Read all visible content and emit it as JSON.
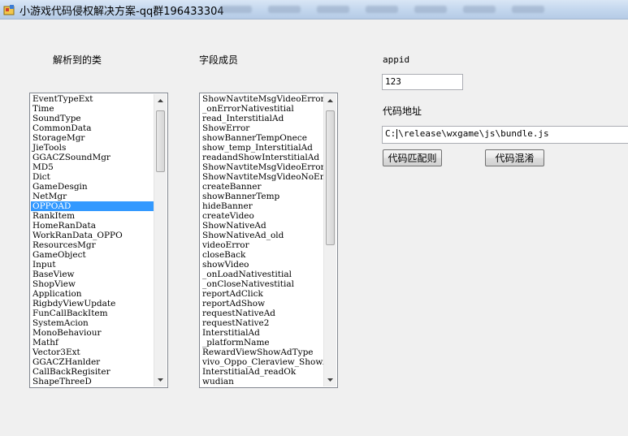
{
  "window": {
    "title": "小游戏代码侵权解决方案-qq群196433304"
  },
  "labels": {
    "classes": "解析到的类",
    "fields": "字段成员",
    "appid": "appid",
    "code_path": "代码地址"
  },
  "inputs": {
    "appid_value": "123",
    "path_prefix": "C:",
    "path_rest": "\\release\\wxgame\\js\\bundle.js"
  },
  "buttons": {
    "match": "代码匹配则",
    "obfuscate": "代码混淆"
  },
  "class_list": {
    "selected_index": 11,
    "items": [
      "EventTypeExt",
      "Time",
      "SoundType",
      "CommonData",
      "StorageMgr",
      "JieTools",
      "GGACZSoundMgr",
      "MD5",
      "Dict",
      "GameDesgin",
      "NetMgr",
      "OPPOAD",
      "RankItem",
      "HomeRanData",
      "WorkRanData_OPPO",
      "ResourcesMgr",
      "GameObject",
      "Input",
      "BaseView",
      "ShopView",
      "Application",
      "RigbdyViewUpdate",
      "FunCallBackItem",
      "SystemAcion",
      "MonoBehaviour",
      "Mathf",
      "Vector3Ext",
      "GGACZHanlder",
      "CallBackRegisiter",
      "ShapeThreeD"
    ]
  },
  "field_list": {
    "items": [
      "ShowNavtiteMsgVideoErrorI",
      "_onErrorNativestitial",
      "read_InterstitialAd",
      "ShowError",
      "showBannerTempOnece",
      "show_temp_InterstitialAd",
      "readandShowInterstitialAd",
      "ShowNavtiteMsgVideoError",
      "ShowNavtiteMsgVideoNoEnd",
      "createBanner",
      "showBannerTemp",
      "hideBanner",
      "createVideo",
      "ShowNativeAd",
      "ShowNativeAd_old",
      "videoError",
      "closeBack",
      "showVideo",
      "_onLoadNativestitial",
      "_onCloseNativestitial",
      "reportAdClick",
      "reportAdShow",
      "requestNativeAd",
      "requestNative2",
      "InterstitialAd",
      "_platformName",
      "RewardViewShowAdType",
      "vivo_Oppo_Cleraview_ShowA",
      "InterstitialAd_readOk",
      "wudian"
    ]
  },
  "icons": {
    "app": "app-icon",
    "scroll_up": "arrow-up-icon",
    "scroll_down": "arrow-down-icon"
  },
  "colors": {
    "selection": "#3399ff",
    "window_bg": "#f0f0f0"
  }
}
